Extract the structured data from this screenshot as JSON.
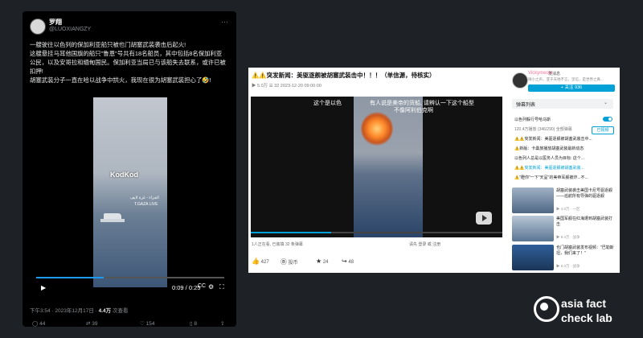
{
  "tweet": {
    "user_name": "罗翔",
    "user_handle": "@LUOXIANGZY",
    "more": "···",
    "text_lines": [
      "一艘驶往以色列的保加利亚船只被也门胡塞武装袭击后起火!",
      "这艘悬挂马耳他国旗的船只\"鲁恩\"号共有18名船员，其中包括8名保加利亚",
      "公民，以及安哥拉和缅甸国民。保加利亚当局已与该船失去联系，或许已被",
      "扣押!",
      "胡塞武装分子一直在哈以战争中拱火，我现在很为胡塞武装担心了🤣!"
    ],
    "video": {
      "watermark": "KodKod",
      "watermark_ar1": "الجزاء - غزة لايف",
      "watermark_ar2": "T.GAZA LIVE",
      "time": "0:09 / 0:25",
      "play_icon": "▶",
      "progress": 0.36
    },
    "meta_time": "下午3:54 · 2023年12月17日 · ",
    "meta_views": "4.4万",
    "meta_views_label": " 次查看",
    "actions": {
      "replies": "44",
      "retweets": "39",
      "likes": "154",
      "bookmarks": "8"
    }
  },
  "video_page": {
    "title": "⚠️⚠️突发新闻：美驱逐舰被胡塞武装击中！！！（单信源，待核实）",
    "subtitle": "▶ 5.0万   ☰ 32   2023-12-20 09:00:00",
    "captions": [
      "这个是以色",
      "有人说是美帝的货船, 请辨认一下这个船型",
      "不像阿利伯克啊"
    ],
    "info_left": "1人正在看, 已装填 32 条弹幕",
    "info_right": "请先 登录 或 注册",
    "progress": 0.32,
    "actions": [
      {
        "icon": "👍",
        "value": "427"
      },
      {
        "icon": "Ⓑ",
        "value": "投币"
      },
      {
        "icon": "★",
        "value": "24"
      },
      {
        "icon": "↪",
        "value": "48"
      }
    ]
  },
  "sidebar": {
    "user": "Vickymeole",
    "tag": "发消息",
    "desc": "微小之声，亚于天地不言，坚信，是世界之真...",
    "follow": "+ 关注 936",
    "danmaku_title": "弹幕列表",
    "danmaku_arrow": "⌄",
    "rows": [
      "以色列躲行号哈马斯",
      "120.4万播放  (346/290)  全部弹幕",
      "⚠️⚠️突发新闻：美驱逐舰被胡塞武装击中...",
      "⚠️新版：卡桑旅播放胡塞武装最新动态",
      "以色列人总是以医务人员为目标: 这个...",
      "⚠️⚠️突发新闻：美驱逐舰被胡塞武装...",
      "⚠️\"瞪你\"一下\"天呈\"的美帝军舰被炸...不..."
    ],
    "send": "已视频",
    "recs": [
      {
        "title": "胡塞武装袭击美国卡尼号驱逐舰——巡航所有导弹的驱逐舰",
        "meta": "▶ 4.0万  · 一区"
      },
      {
        "title": "美国军舰在红海遭到胡塞武装打击",
        "meta": "▶ 8.4万  · 战争"
      },
      {
        "title": "也门胡塞武装发布视频：\"巴勒斯坦，我们来了！\"",
        "meta": "▶ 6.0万  · 战争"
      }
    ]
  },
  "logo": {
    "line1": "asia fact",
    "line2": "check lab"
  },
  "colors": {
    "accent_bili": "#00a1d6",
    "twitter_blue": "#1d9bf0",
    "background": "#1e2126"
  }
}
